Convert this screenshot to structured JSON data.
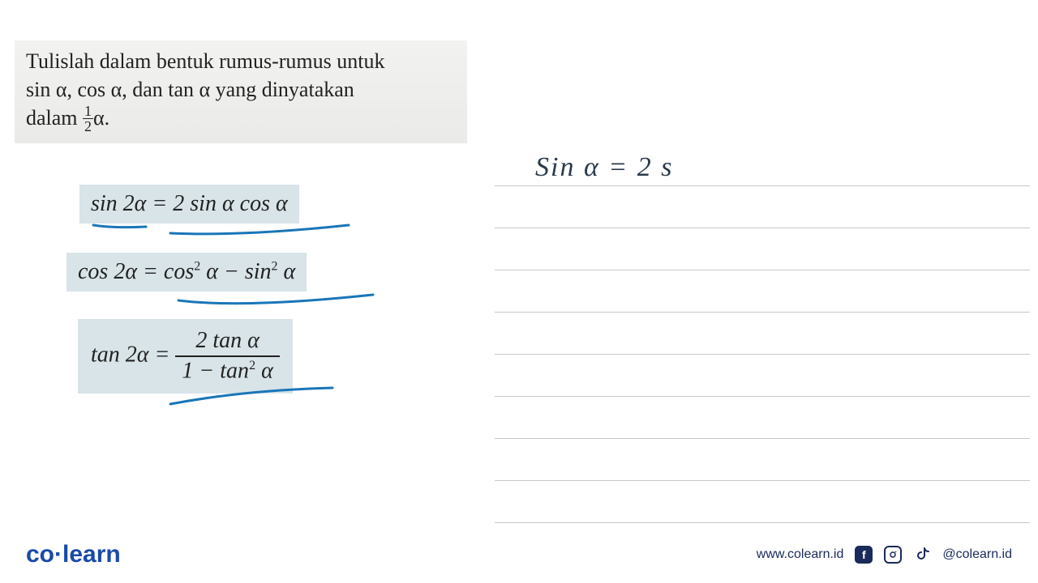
{
  "question": {
    "line1": "Tulislah dalam bentuk rumus-rumus untuk",
    "line2_pre": "sin α, cos α, dan tan α yang dinyatakan",
    "line3_pre": "dalam ",
    "frac_num": "1",
    "frac_den": "2",
    "line3_post": "α."
  },
  "formulas": {
    "sin": "sin 2α = 2 sin α cos α",
    "cos_left": "cos 2α = cos",
    "cos_mid": " α − sin",
    "cos_right": " α",
    "tan_left": "tan 2α = ",
    "tan_num": "2 tan α",
    "tan_den_pre": "1 − tan",
    "tan_den_post": " α",
    "sup": "2"
  },
  "handwriting": "Sin α = 2 s",
  "footer": {
    "logo_co": "co",
    "logo_learn": "learn",
    "url": "www.colearn.id",
    "handle": "@colearn.id"
  }
}
